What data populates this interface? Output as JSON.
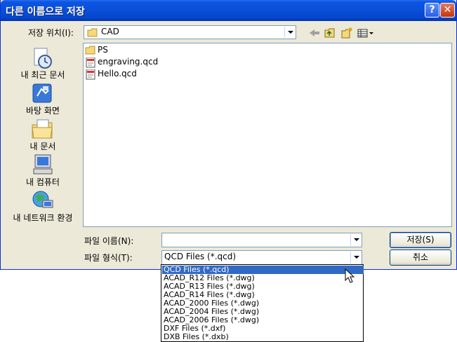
{
  "window": {
    "title": "다른 이름으로 저장"
  },
  "lookin": {
    "label": "저장 위치(I):",
    "value": "CAD"
  },
  "places": [
    {
      "label": "내 최근 문서",
      "icon": "recent-docs-icon"
    },
    {
      "label": "바탕 화면",
      "icon": "desktop-icon"
    },
    {
      "label": "내 문서",
      "icon": "my-docs-icon"
    },
    {
      "label": "내 컴퓨터",
      "icon": "my-computer-icon"
    },
    {
      "label": "내 네트워크 환경",
      "icon": "network-icon"
    }
  ],
  "files": [
    {
      "name": "PS",
      "type": "folder"
    },
    {
      "name": "engraving.qcd",
      "type": "qcd"
    },
    {
      "name": "Hello.qcd",
      "type": "qcd"
    }
  ],
  "filename": {
    "label": "파일 이름(N):",
    "value": ""
  },
  "filetype": {
    "label": "파일 형식(T):",
    "value": "QCD Files (*.qcd)"
  },
  "buttons": {
    "save": "저장(S)",
    "cancel": "취소"
  },
  "dropdown": [
    "QCD Files (*.qcd)",
    "ACAD_R12 Files (*.dwg)",
    "ACAD_R13 Files (*.dwg)",
    "ACAD_R14 Files (*.dwg)",
    "ACAD_2000 Files (*.dwg)",
    "ACAD_2004 Files (*.dwg)",
    "ACAD_2006 Files (*.dwg)",
    "DXF Files (*.dxf)",
    "DXB Files (*.dxb)"
  ],
  "colors": {
    "titlebar": "#0a4fd6",
    "selection": "#316ac5",
    "dialog": "#ece9d8"
  }
}
